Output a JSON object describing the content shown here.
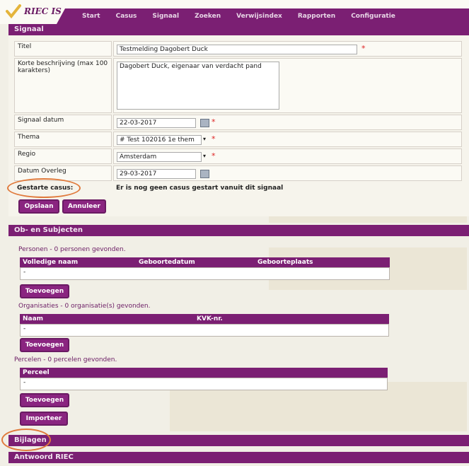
{
  "app": {
    "logo_text": "RIEC IS"
  },
  "nav": {
    "items": [
      "Start",
      "Casus",
      "Signaal",
      "Zoeken",
      "Verwijsindex",
      "Rapporten",
      "Configuratie"
    ]
  },
  "signaal": {
    "section_title": "Signaal",
    "fields": {
      "titel": {
        "label": "Titel",
        "value": "Testmelding Dagobert Duck"
      },
      "beschrijving": {
        "label": "Korte beschrijving (max 100 karakters)",
        "value": "Dagobert Duck, eigenaar van verdacht pand"
      },
      "datum": {
        "label": "Signaal datum",
        "value": "22-03-2017"
      },
      "thema": {
        "label": "Thema",
        "value": "# Test 102016 1e them"
      },
      "regio": {
        "label": "Regio",
        "value": "Amsterdam"
      },
      "overleg": {
        "label": "Datum Overleg",
        "value": "29-03-2017"
      },
      "casus": {
        "label": "Gestarte casus:",
        "value": "Er is nog geen casus gestart vanuit dit signaal"
      }
    },
    "buttons": {
      "save": "Opslaan",
      "cancel": "Annuleer"
    }
  },
  "objects": {
    "section_title": "Ob- en Subjecten",
    "personen": {
      "count_text": "Personen - 0 personen gevonden.",
      "columns": [
        "Volledige naam",
        "Geboortedatum",
        "Geboorteplaats"
      ],
      "empty": "-",
      "button": "Toevoegen"
    },
    "organisaties": {
      "count_text": "Organisaties - 0 organisatie(s) gevonden.",
      "columns": [
        "Naam",
        "KVK-nr."
      ],
      "empty": "-",
      "button": "Toevoegen"
    },
    "percelen": {
      "count_text": "Percelen - 0 percelen gevonden.",
      "columns": [
        "Perceel"
      ],
      "empty": "-",
      "button": "Toevoegen"
    },
    "import_button": "Importeer"
  },
  "bijlagen": {
    "title": "Bijlagen"
  },
  "antwoord": {
    "title": "Antwoord RIEC"
  }
}
